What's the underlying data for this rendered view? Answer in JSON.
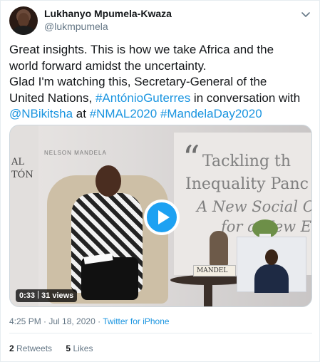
{
  "user": {
    "name": "Lukhanyo Mpumela-Kwaza",
    "handle": "@lukmpumela"
  },
  "tweet": {
    "line1": "Great insights. This is how we take Africa and the",
    "line2": "world forward amidst the uncertainty.",
    "line3": "Glad I'm watching this, Secretary-General of the",
    "line4_text": "United Nations, ",
    "line4_link": "#AntónioGuterres",
    "line4_rest": " in conversation with",
    "line5_mention": "@NBikitsha",
    "line5_at": " at ",
    "line5_tag1": "#NMAL2020",
    "line5_space": " ",
    "line5_tag2": "#MandelaDay2020"
  },
  "video": {
    "duration": "0:33",
    "views": "31 views",
    "banner_line1": "Tackling th",
    "banner_line2": "Inequality Panc",
    "banner_line3": "A New Social Co",
    "banner_line4": "for a New E",
    "panel_line1": "AL",
    "panel_line2": "TÓN",
    "logo": "NELSON MANDELA",
    "book_label": "MANDEL"
  },
  "meta": {
    "timestamp": "4:25 PM · Jul 18, 2020 · ",
    "source": "Twitter for iPhone"
  },
  "stats": {
    "retweets_count": "2",
    "retweets_label": "Retweets",
    "likes_count": "5",
    "likes_label": "Likes"
  },
  "colors": {
    "link": "#1b95e0",
    "play_button": "#1da1f2"
  },
  "icons": {
    "menu": "chevron-down-icon",
    "play": "play-icon"
  }
}
